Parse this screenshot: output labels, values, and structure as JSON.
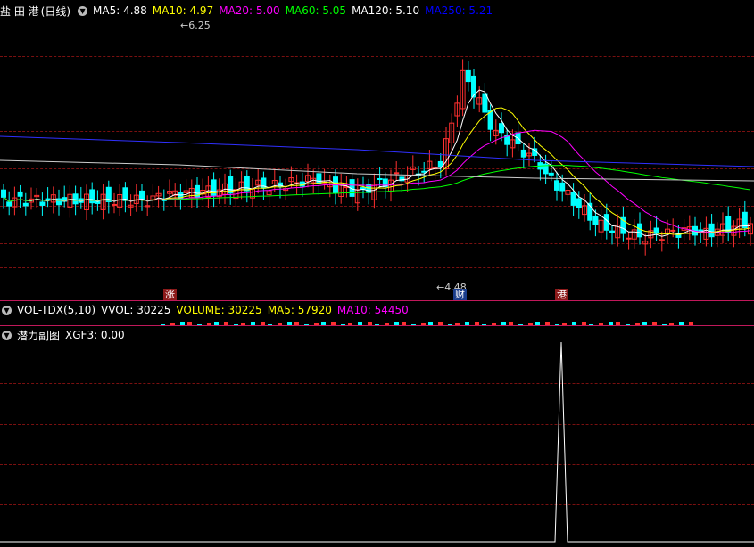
{
  "price_panel": {
    "stock_name": "盐 田 港",
    "period": "(日线)",
    "indicators": [
      {
        "label": "MA5: 4.88",
        "color": "#ffffff"
      },
      {
        "label": "MA10: 4.97",
        "color": "#ffff00"
      },
      {
        "label": "MA20: 5.00",
        "color": "#ff00ff"
      },
      {
        "label": "MA60: 5.05",
        "color": "#00ff00"
      },
      {
        "label": "MA120: 5.10",
        "color": "#ffffff"
      },
      {
        "label": "MA250: 5.21",
        "color": "#0000ff"
      }
    ],
    "high_label": "6.25",
    "low_label": "4.48",
    "markers": [
      {
        "text": "涨",
        "bg": "#8b1a1a",
        "color": "#ffffff"
      },
      {
        "text": "财",
        "bg": "#1a3d8b",
        "color": "#ffffff"
      },
      {
        "text": "港",
        "bg": "#8b1a1a",
        "color": "#ffffff"
      }
    ]
  },
  "volume_panel": {
    "name": "VOL-TDX(5,10)",
    "indicators": [
      {
        "label": "VVOL: 30225",
        "color": "#ffffff"
      },
      {
        "label": "VOLUME: 30225",
        "color": "#ffff00"
      },
      {
        "label": "MA5: 57920",
        "color": "#ffff00"
      },
      {
        "label": "MA10: 54450",
        "color": "#ff00ff"
      }
    ]
  },
  "sub_panel": {
    "name": "潜力副图",
    "indicators": [
      {
        "label": "XGF3: 0.00",
        "color": "#ffffff"
      }
    ]
  },
  "colors": {
    "up": "#ff3030",
    "down": "#00ffff",
    "grid": "#7a1010",
    "separator": "#c0185a"
  }
}
